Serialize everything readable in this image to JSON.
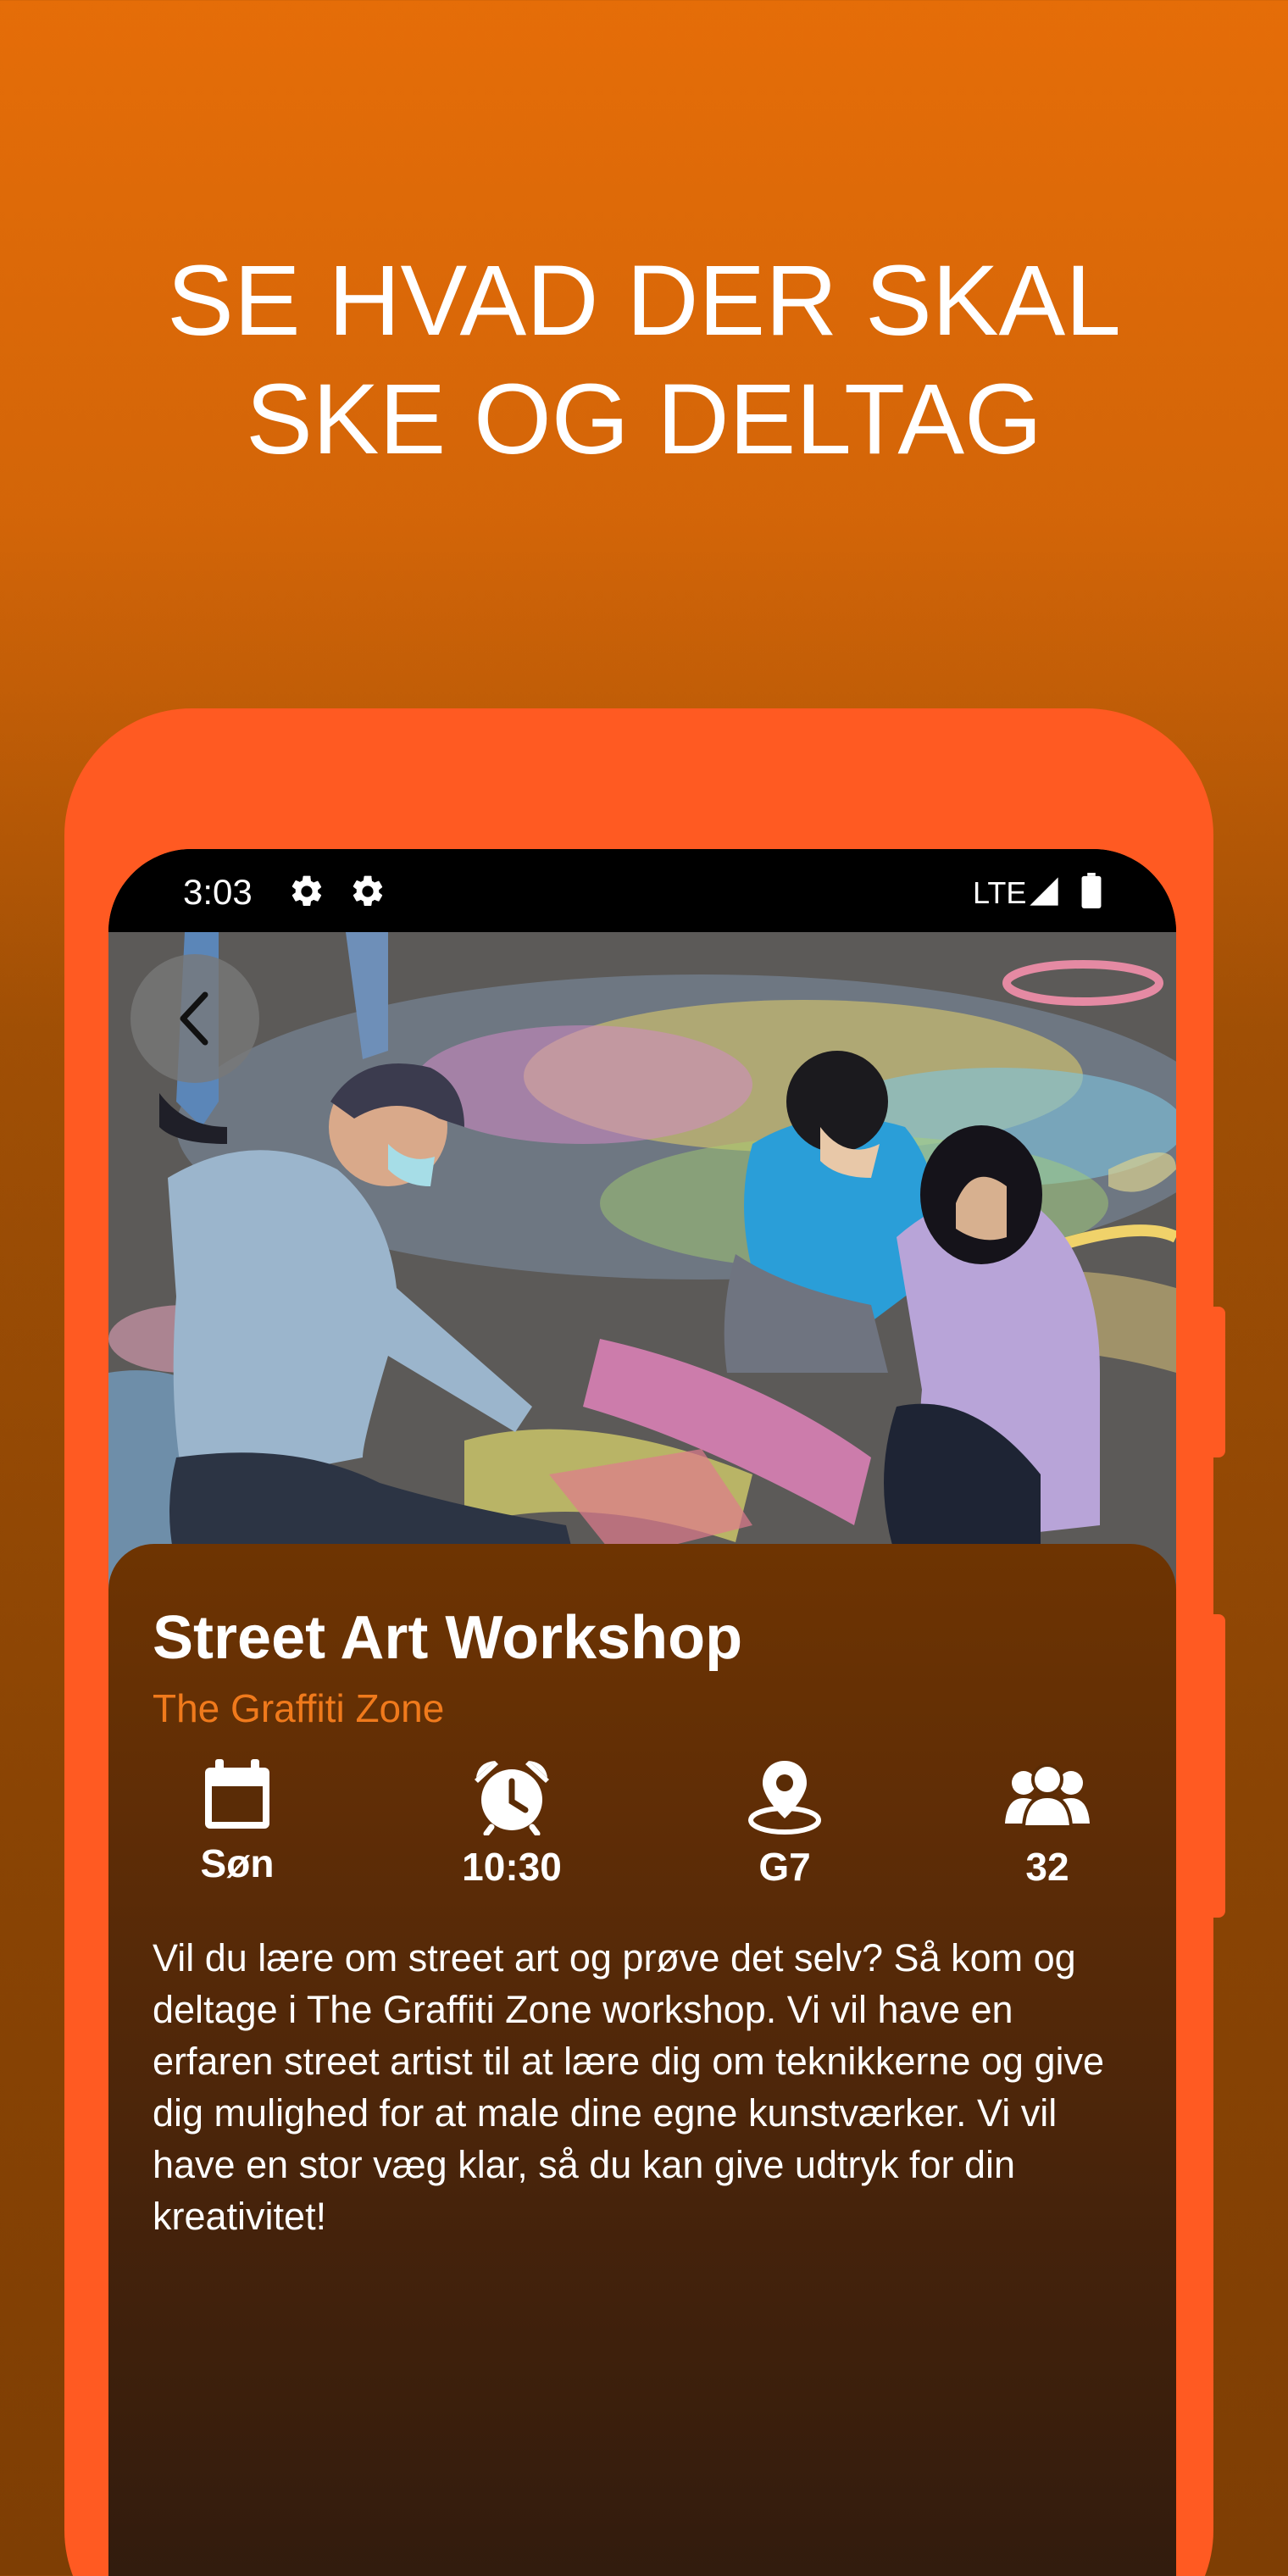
{
  "promo": {
    "headline_line1": "SE HVAD DER SKAL",
    "headline_line2": "SKE OG DELTAG"
  },
  "status_bar": {
    "time": "3:03",
    "network": "LTE",
    "icons": [
      "gear-icon",
      "gear-icon",
      "signal-icon",
      "battery-icon"
    ]
  },
  "event": {
    "title": "Street Art Workshop",
    "venue": "The Graffiti Zone",
    "day": "Søn",
    "time": "10:30",
    "location": "G7",
    "attendees": "32",
    "description": "Vil du lære om street art og prøve det selv? Så kom og deltage i The Graffiti Zone workshop. Vi vil have en erfaren street artist til at lære dig om teknikkerne og give dig mulighed for at male dine egne kunstværker. Vi vil have en stor væg klar, så du kan give udtryk for din kreativitet!"
  },
  "icons": {
    "back": "chevron-left-icon",
    "day": "calendar-icon",
    "time": "alarm-clock-icon",
    "location": "location-pin-icon",
    "attendees": "group-icon"
  },
  "colors": {
    "background_top": "#e56d08",
    "phone_frame": "#ff5a22",
    "venue_accent": "#f07a1c",
    "panel_top": "#6e3402",
    "panel_bottom": "#2e1a0e"
  }
}
